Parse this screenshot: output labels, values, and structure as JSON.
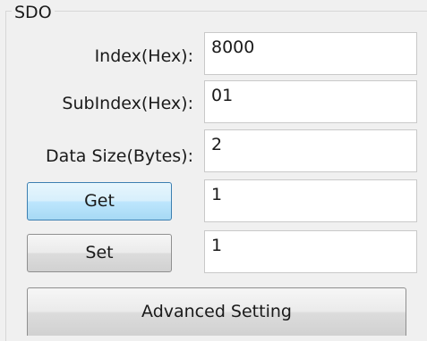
{
  "sdo": {
    "group_title": "SDO",
    "index": {
      "label": "Index(Hex):",
      "value": "8000"
    },
    "subindex": {
      "label": "SubIndex(Hex):",
      "value": "01"
    },
    "data_size": {
      "label": "Data Size(Bytes):",
      "value": "2"
    },
    "get": {
      "label": "Get",
      "value": "1"
    },
    "set": {
      "label": "Set",
      "value": "1"
    },
    "advanced_label": "Advanced Setting"
  },
  "colors": {
    "background": "#f0f0f0",
    "field_border": "#c9c9c9",
    "active_button": "#bde6fd"
  }
}
